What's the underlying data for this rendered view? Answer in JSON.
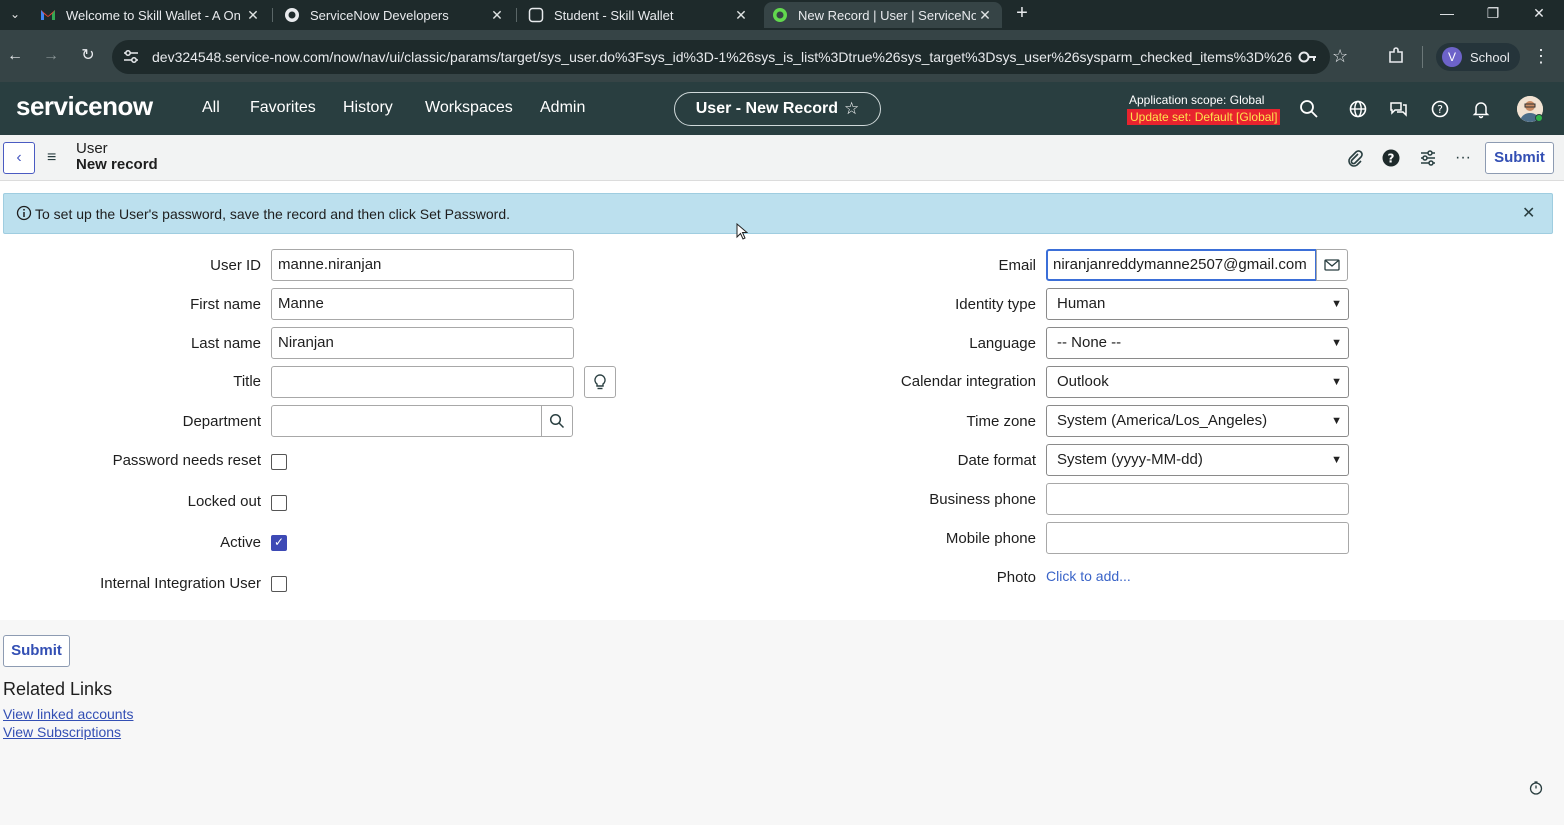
{
  "browser": {
    "tabs": [
      {
        "label": "Welcome to Skill Wallet - A On",
        "icon": "gmail-icon",
        "close": "✕"
      },
      {
        "label": "ServiceNow Developers",
        "icon": "servicenow-icon",
        "close": "✕"
      },
      {
        "label": "Student - Skill Wallet",
        "icon": "page-icon",
        "close": "✕"
      },
      {
        "label": "New Record | User | ServiceNow",
        "icon": "servicenow-icon",
        "close": "✕"
      }
    ],
    "new_tab": "+",
    "window_controls": {
      "minimize": "—",
      "restore": "❐",
      "close": "✕"
    },
    "url": "dev324548.service-now.com/now/nav/ui/classic/params/target/sys_user.do%3Fsys_id%3D-1%26sys_is_list%3Dtrue%26sys_target%3Dsys_user%26sysparm_checked_items%3D%26...",
    "profile": {
      "initial": "V",
      "name": "School"
    }
  },
  "header": {
    "logo": "servicenow",
    "nav": [
      "All",
      "Favorites",
      "History",
      "Workspaces",
      "Admin"
    ],
    "record_pill": "User - New Record",
    "scope_label": "Application scope: Global",
    "update_set": "Update set: Default [Global]"
  },
  "form_header": {
    "table": "User",
    "subtitle": "New record",
    "submit_label": "Submit"
  },
  "banner": {
    "text": "To set up the User's password, save the record and then click Set Password."
  },
  "form": {
    "left": {
      "user_id": {
        "label": "User ID",
        "value": "manne.niranjan"
      },
      "first_name": {
        "label": "First name",
        "value": "Manne"
      },
      "last_name": {
        "label": "Last name",
        "value": "Niranjan"
      },
      "title": {
        "label": "Title",
        "value": ""
      },
      "department": {
        "label": "Department",
        "value": ""
      },
      "password_needs_reset": {
        "label": "Password needs reset",
        "checked": false
      },
      "locked_out": {
        "label": "Locked out",
        "checked": false
      },
      "active": {
        "label": "Active",
        "checked": true
      },
      "internal_integration_user": {
        "label": "Internal Integration User",
        "checked": false
      }
    },
    "right": {
      "email": {
        "label": "Email",
        "value": "niranjanreddymanne2507@gmail.com"
      },
      "identity_type": {
        "label": "Identity type",
        "value": "Human"
      },
      "language": {
        "label": "Language",
        "value": "-- None --"
      },
      "calendar_integration": {
        "label": "Calendar integration",
        "value": "Outlook"
      },
      "time_zone": {
        "label": "Time zone",
        "value": "System (America/Los_Angeles)"
      },
      "date_format": {
        "label": "Date format",
        "value": "System (yyyy-MM-dd)"
      },
      "business_phone": {
        "label": "Business phone",
        "value": ""
      },
      "mobile_phone": {
        "label": "Mobile phone",
        "value": ""
      },
      "photo": {
        "label": "Photo",
        "link": "Click to add..."
      }
    }
  },
  "footer": {
    "submit_label": "Submit",
    "related_links_title": "Related Links",
    "links": [
      "View linked accounts",
      "View Subscriptions"
    ]
  },
  "colors": {
    "header_bg": "#293e40",
    "accent": "#334fb4",
    "banner_bg": "#bce0ee",
    "update_set_bg": "#e8232e"
  }
}
